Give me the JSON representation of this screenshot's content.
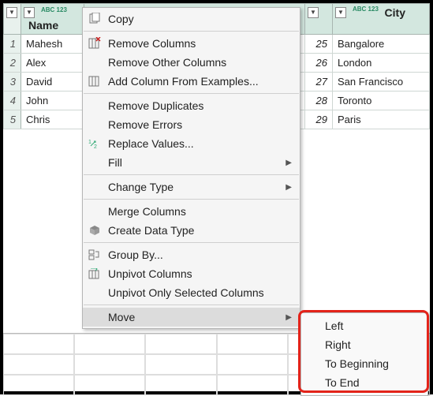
{
  "columns": {
    "typePrefix": "ABC\n123",
    "name": "Name",
    "city": "City"
  },
  "rows": [
    {
      "n": "1",
      "name": "Mahesh",
      "age": "25",
      "city": "Bangalore"
    },
    {
      "n": "2",
      "name": "Alex",
      "age": "26",
      "city": "London"
    },
    {
      "n": "3",
      "name": "David",
      "age": "27",
      "city": "San Francisco"
    },
    {
      "n": "4",
      "name": "John",
      "age": "28",
      "city": "Toronto"
    },
    {
      "n": "5",
      "name": "Chris",
      "age": "29",
      "city": "Paris"
    }
  ],
  "menu": {
    "copy": "Copy",
    "removeCols": "Remove Columns",
    "removeOther": "Remove Other Columns",
    "addFromEx": "Add Column From Examples...",
    "removeDup": "Remove Duplicates",
    "removeErr": "Remove Errors",
    "replaceVals": "Replace Values...",
    "fill": "Fill",
    "changeType": "Change Type",
    "mergeCols": "Merge Columns",
    "createDT": "Create Data Type",
    "groupBy": "Group By...",
    "unpivot": "Unpivot Columns",
    "unpivotSel": "Unpivot Only Selected Columns",
    "move": "Move"
  },
  "submenu": {
    "left": "Left",
    "right": "Right",
    "toBeg": "To Beginning",
    "toEnd": "To End"
  }
}
